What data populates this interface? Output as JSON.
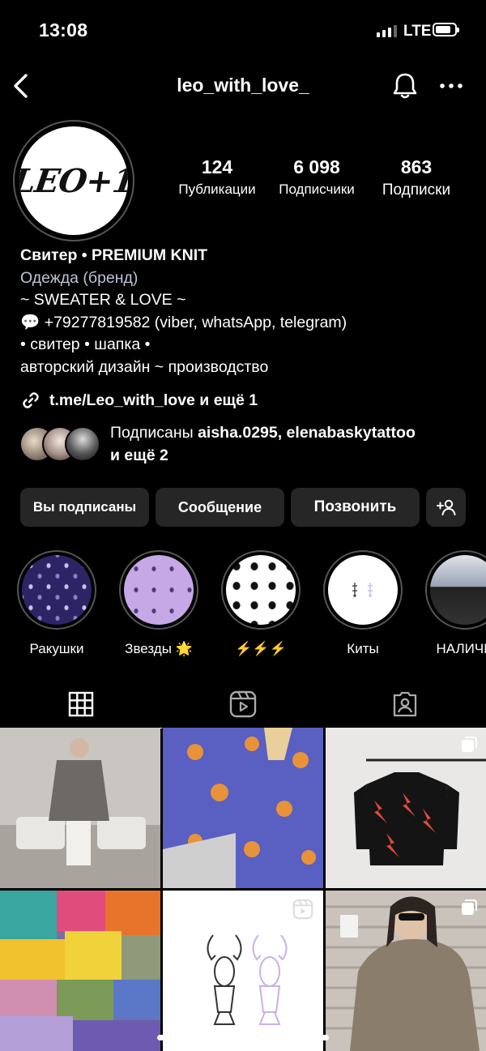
{
  "status": {
    "time": "13:08",
    "network": "LTE"
  },
  "header": {
    "username": "leo_with_love_"
  },
  "avatar": {
    "logo_text": "LEO+1"
  },
  "stats": [
    {
      "value": "124",
      "label": "Публикации"
    },
    {
      "value": "6 098",
      "label": "Подписчики"
    },
    {
      "value": "863",
      "label": "Подписки"
    }
  ],
  "bio": {
    "name": "Свитер • PREMIUM KNIT",
    "category": "Одежда (бренд)",
    "lines": [
      "~ SWEATER & LOVE ~",
      "💬 +79277819582 (viber, whatsApp, telegram)",
      "• свитер • шапка •",
      "авторский дизайн ~ производство"
    ],
    "link": "t.me/Leo_with_love и ещё 1"
  },
  "mutual": {
    "prefix": "Подписаны ",
    "names": "aisha.0295, elenabaskytattoo",
    "suffix": "и ещё 2"
  },
  "buttons": {
    "following": "Вы подписаны",
    "message": "Сообщение",
    "call": "Позвонить"
  },
  "highlights": [
    {
      "label": "Ракушки"
    },
    {
      "label": "Звезды 🌟"
    },
    {
      "label": "⚡️⚡️⚡️"
    },
    {
      "label": "Киты"
    },
    {
      "label": "НАЛИЧИ"
    }
  ],
  "colors": {
    "background": "#000000",
    "button": "#262626",
    "category": "#bdc3d6"
  }
}
